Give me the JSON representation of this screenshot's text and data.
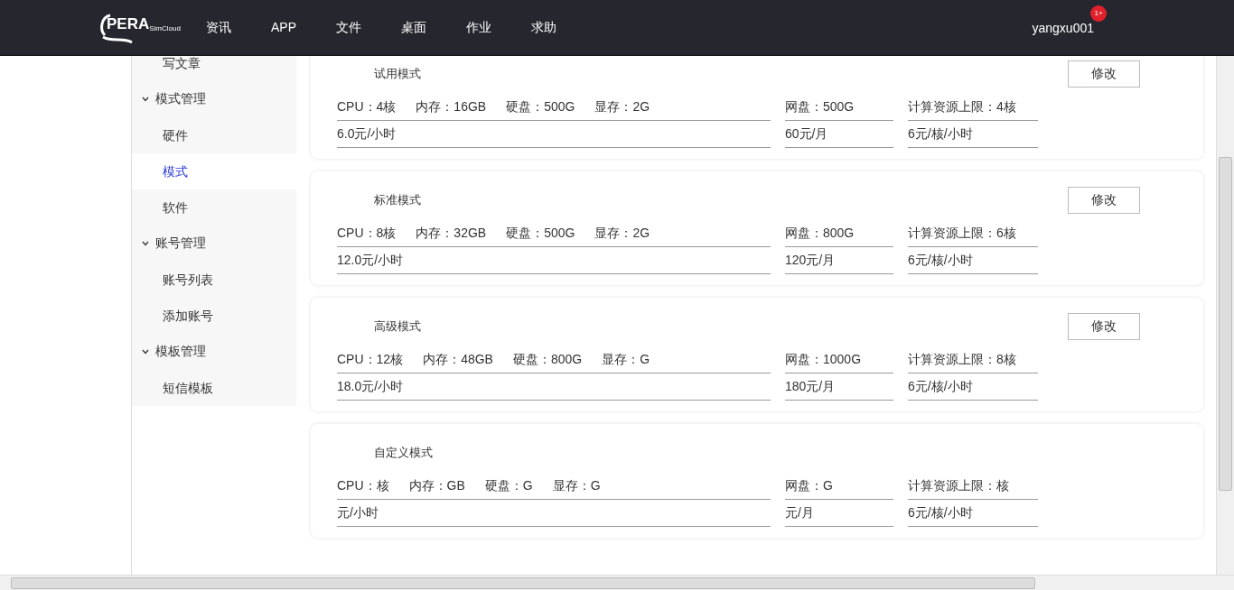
{
  "header": {
    "logo": {
      "name": "PERA",
      "sub": "SimCloud"
    },
    "nav": [
      "资讯",
      "APP",
      "文件",
      "桌面",
      "作业",
      "求助"
    ],
    "user": "yangxu001",
    "badge": "1+"
  },
  "sidebar": {
    "items": [
      {
        "kind": "link",
        "label": "写文章",
        "selected": false
      },
      {
        "kind": "group",
        "label": "模式管理",
        "expanded": true,
        "children": [
          {
            "label": "硬件",
            "selected": false
          },
          {
            "label": "模式",
            "selected": true
          },
          {
            "label": "软件",
            "selected": false
          }
        ]
      },
      {
        "kind": "group",
        "label": "账号管理",
        "expanded": true,
        "children": [
          {
            "label": "账号列表",
            "selected": false
          },
          {
            "label": "添加账号",
            "selected": false
          }
        ]
      },
      {
        "kind": "group",
        "label": "模板管理",
        "expanded": true,
        "children": [
          {
            "label": "短信模板",
            "selected": false
          }
        ]
      }
    ]
  },
  "modes": [
    {
      "title": "试用模式",
      "specs": [
        "CPU：4核",
        "内存：16GB",
        "硬盘：500G",
        "显存：2G"
      ],
      "price": "6.0元/小时",
      "disk": "网盘：500G",
      "disk_price": "60元/月",
      "limit": "计算资源上限：4核",
      "limit_price": "6元/核/小时",
      "button": "修改"
    },
    {
      "title": "标准模式",
      "specs": [
        "CPU：8核",
        "内存：32GB",
        "硬盘：500G",
        "显存：2G"
      ],
      "price": "12.0元/小时",
      "disk": "网盘：800G",
      "disk_price": "120元/月",
      "limit": "计算资源上限：6核",
      "limit_price": "6元/核/小时",
      "button": "修改"
    },
    {
      "title": "高级模式",
      "specs": [
        "CPU：12核",
        "内存：48GB",
        "硬盘：800G",
        "显存：G"
      ],
      "price": "18.0元/小时",
      "disk": "网盘：1000G",
      "disk_price": "180元/月",
      "limit": "计算资源上限：8核",
      "limit_price": "6元/核/小时",
      "button": "修改"
    },
    {
      "title": "自定义模式",
      "specs": [
        "CPU：核",
        "内存：GB",
        "硬盘：G",
        "显存：G"
      ],
      "price": "元/小时",
      "disk": "网盘：G",
      "disk_price": "元/月",
      "limit": "计算资源上限：核",
      "limit_price": "6元/核/小时"
    }
  ]
}
